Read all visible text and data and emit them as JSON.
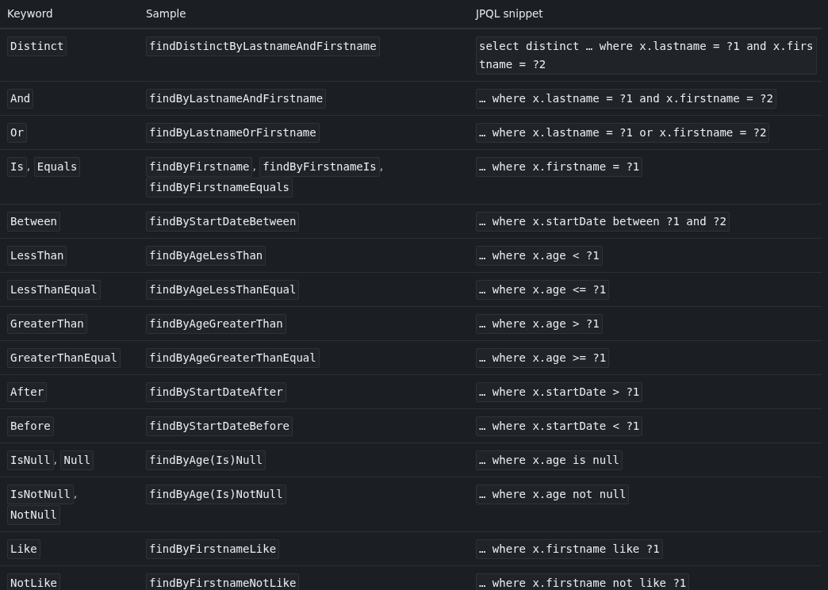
{
  "table": {
    "columns": [
      "Keyword",
      "Sample",
      "JPQL snippet"
    ],
    "rows": [
      {
        "keyword": {
          "codes": [
            "Distinct"
          ]
        },
        "sample": {
          "codes": [
            "findDistinctByLastnameAndFirstname"
          ]
        },
        "jpql": {
          "codes": [
            "select distinct … where x.lastname = ?1 and x.firstname = ?2"
          ]
        }
      },
      {
        "keyword": {
          "codes": [
            "And"
          ]
        },
        "sample": {
          "codes": [
            "findByLastnameAndFirstname"
          ]
        },
        "jpql": {
          "codes": [
            "… where x.lastname = ?1 and x.firstname = ?2"
          ]
        }
      },
      {
        "keyword": {
          "codes": [
            "Or"
          ]
        },
        "sample": {
          "codes": [
            "findByLastnameOrFirstname"
          ]
        },
        "jpql": {
          "codes": [
            "… where x.lastname = ?1 or x.firstname = ?2"
          ]
        }
      },
      {
        "keyword": {
          "codes": [
            "Is",
            "Equals"
          ],
          "separator": ","
        },
        "sample": {
          "codes": [
            "findByFirstname",
            "findByFirstnameIs",
            "findByFirstnameEquals"
          ],
          "separator": ","
        },
        "jpql": {
          "codes": [
            "… where x.firstname = ?1"
          ]
        }
      },
      {
        "keyword": {
          "codes": [
            "Between"
          ]
        },
        "sample": {
          "codes": [
            "findByStartDateBetween"
          ]
        },
        "jpql": {
          "codes": [
            "… where x.startDate between ?1 and ?2"
          ]
        }
      },
      {
        "keyword": {
          "codes": [
            "LessThan"
          ]
        },
        "sample": {
          "codes": [
            "findByAgeLessThan"
          ]
        },
        "jpql": {
          "codes": [
            "… where x.age < ?1"
          ]
        }
      },
      {
        "keyword": {
          "codes": [
            "LessThanEqual"
          ]
        },
        "sample": {
          "codes": [
            "findByAgeLessThanEqual"
          ]
        },
        "jpql": {
          "codes": [
            "… where x.age <= ?1"
          ]
        }
      },
      {
        "keyword": {
          "codes": [
            "GreaterThan"
          ]
        },
        "sample": {
          "codes": [
            "findByAgeGreaterThan"
          ]
        },
        "jpql": {
          "codes": [
            "… where x.age > ?1"
          ]
        }
      },
      {
        "keyword": {
          "codes": [
            "GreaterThanEqual"
          ]
        },
        "sample": {
          "codes": [
            "findByAgeGreaterThanEqual"
          ]
        },
        "jpql": {
          "codes": [
            "… where x.age >= ?1"
          ]
        }
      },
      {
        "keyword": {
          "codes": [
            "After"
          ]
        },
        "sample": {
          "codes": [
            "findByStartDateAfter"
          ]
        },
        "jpql": {
          "codes": [
            "… where x.startDate > ?1"
          ]
        }
      },
      {
        "keyword": {
          "codes": [
            "Before"
          ]
        },
        "sample": {
          "codes": [
            "findByStartDateBefore"
          ]
        },
        "jpql": {
          "codes": [
            "… where x.startDate < ?1"
          ]
        }
      },
      {
        "keyword": {
          "codes": [
            "IsNull",
            "Null"
          ],
          "separator": ","
        },
        "sample": {
          "codes": [
            "findByAge(Is)Null"
          ]
        },
        "jpql": {
          "codes": [
            "… where x.age is null"
          ]
        }
      },
      {
        "keyword": {
          "codes": [
            "IsNotNull",
            "NotNull"
          ],
          "separator": ","
        },
        "sample": {
          "codes": [
            "findByAge(Is)NotNull"
          ]
        },
        "jpql": {
          "codes": [
            "… where x.age not null"
          ]
        }
      },
      {
        "keyword": {
          "codes": [
            "Like"
          ]
        },
        "sample": {
          "codes": [
            "findByFirstnameLike"
          ]
        },
        "jpql": {
          "codes": [
            "… where x.firstname like ?1"
          ]
        }
      },
      {
        "keyword": {
          "codes": [
            "NotLike"
          ]
        },
        "sample": {
          "codes": [
            "findByFirstnameNotLike"
          ]
        },
        "jpql": {
          "codes": [
            "… where x.firstname not like ?1"
          ]
        }
      }
    ]
  }
}
